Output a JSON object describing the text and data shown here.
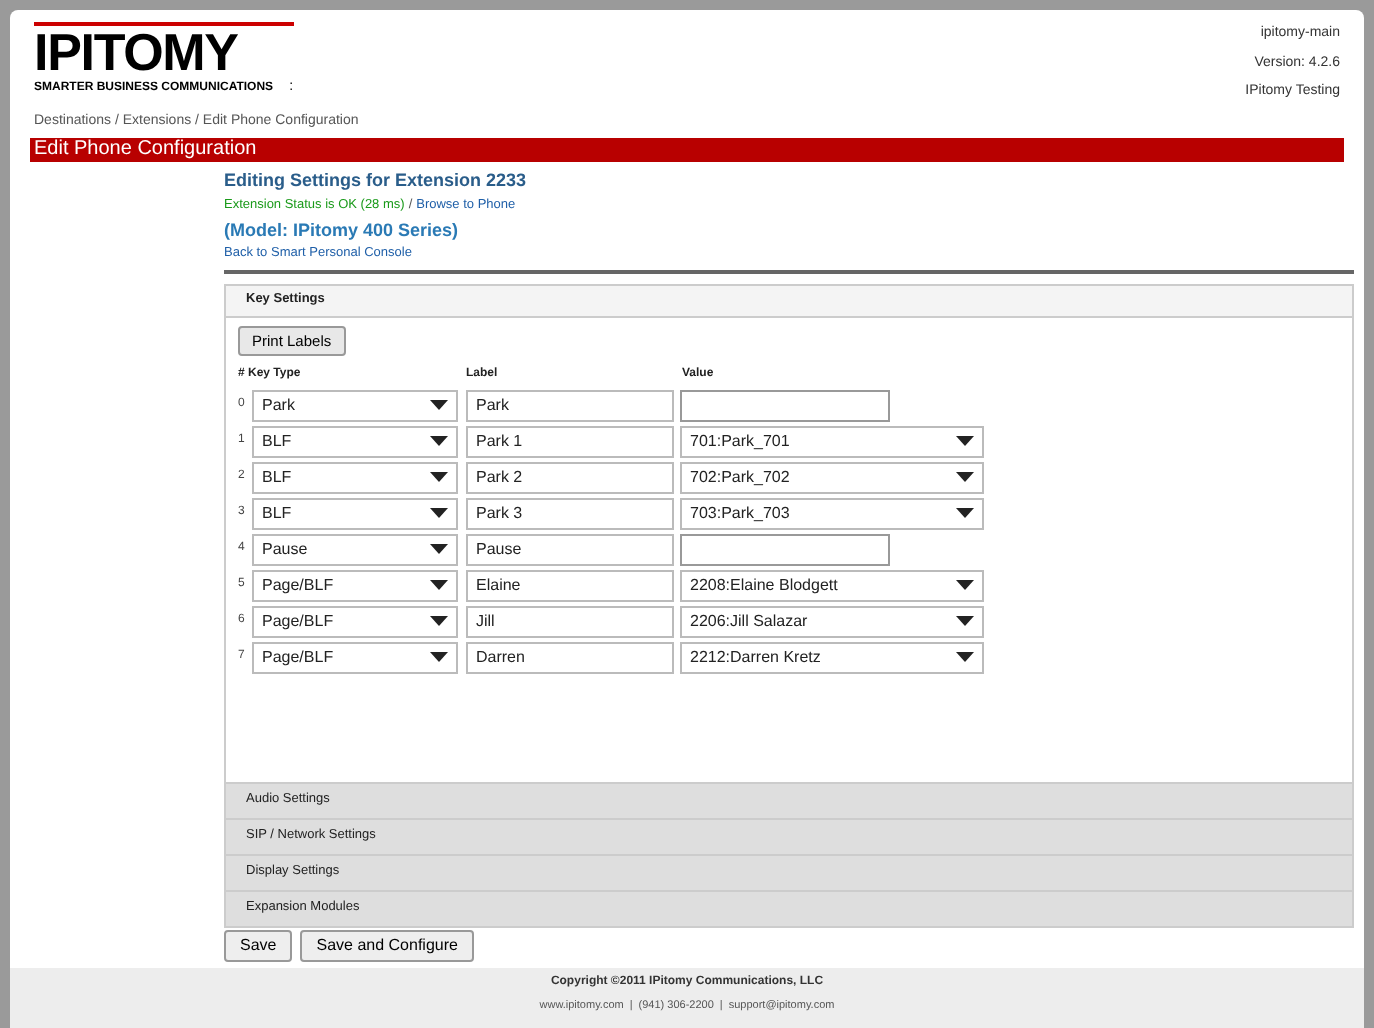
{
  "logo": {
    "name": "IPITOMY",
    "tagline": "SMARTER BUSINESS COMMUNICATIONS",
    "mark": ":"
  },
  "server": [
    "ipitomy-main",
    "Version: 4.2.6",
    "IPitomy Testing"
  ],
  "breadcrumb": "Destinations / Extensions / Edit Phone Configuration",
  "page_title": "Edit Phone Configuration",
  "heading": "Editing Settings for Extension 2233",
  "status": "Extension Status is OK (28 ms)",
  "separator": "/",
  "browse_link": "Browse to Phone",
  "model": "(Model: IPitomy 400 Series)",
  "back_link": "Back to Smart Personal Console",
  "key_settings": {
    "title": "Key Settings",
    "expanded": true,
    "print_button": "Print Labels",
    "columns": [
      "# Key Type",
      "Label",
      "Value"
    ],
    "rows": [
      {
        "index": "0",
        "key_type": "Park",
        "label": "Park",
        "kind": "field"
      },
      {
        "index": "1",
        "key_type": "BLF",
        "label": "Park 1",
        "kind": "select",
        "value": "701:Park_701"
      },
      {
        "index": "2",
        "key_type": "BLF",
        "label": "Park 2",
        "kind": "select",
        "value": "702:Park_702"
      },
      {
        "index": "3",
        "key_type": "BLF",
        "label": "Park 3",
        "kind": "select",
        "value": "703:Park_703"
      },
      {
        "index": "4",
        "key_type": "Pause",
        "label": "Pause",
        "kind": "field"
      },
      {
        "index": "5",
        "key_type": "Page/BLF",
        "label": "Elaine",
        "kind": "select",
        "value": "2208:Elaine Blodgett"
      },
      {
        "index": "6",
        "key_type": "Page/BLF",
        "label": "Jill",
        "kind": "select",
        "value": "2206:Jill Salazar"
      },
      {
        "index": "7",
        "key_type": "Page/BLF",
        "label": "Darren",
        "kind": "select",
        "value": "2212:Darren Kretz"
      }
    ]
  },
  "sections": [
    {
      "title": "Audio Settings",
      "expanded": false
    },
    {
      "title": "SIP / Network Settings",
      "expanded": false
    },
    {
      "title": "Display Settings",
      "expanded": false
    },
    {
      "title": "Expansion Modules",
      "expanded": false
    }
  ],
  "buttons": [
    "Save",
    "Save and Configure"
  ],
  "footer": {
    "copyright": "Copyright ©2011 IPitomy Communications, LLC",
    "links": [
      "www.ipitomy.com",
      "(941) 306-2200",
      "support@ipitomy.com"
    ],
    "separator": "|"
  }
}
